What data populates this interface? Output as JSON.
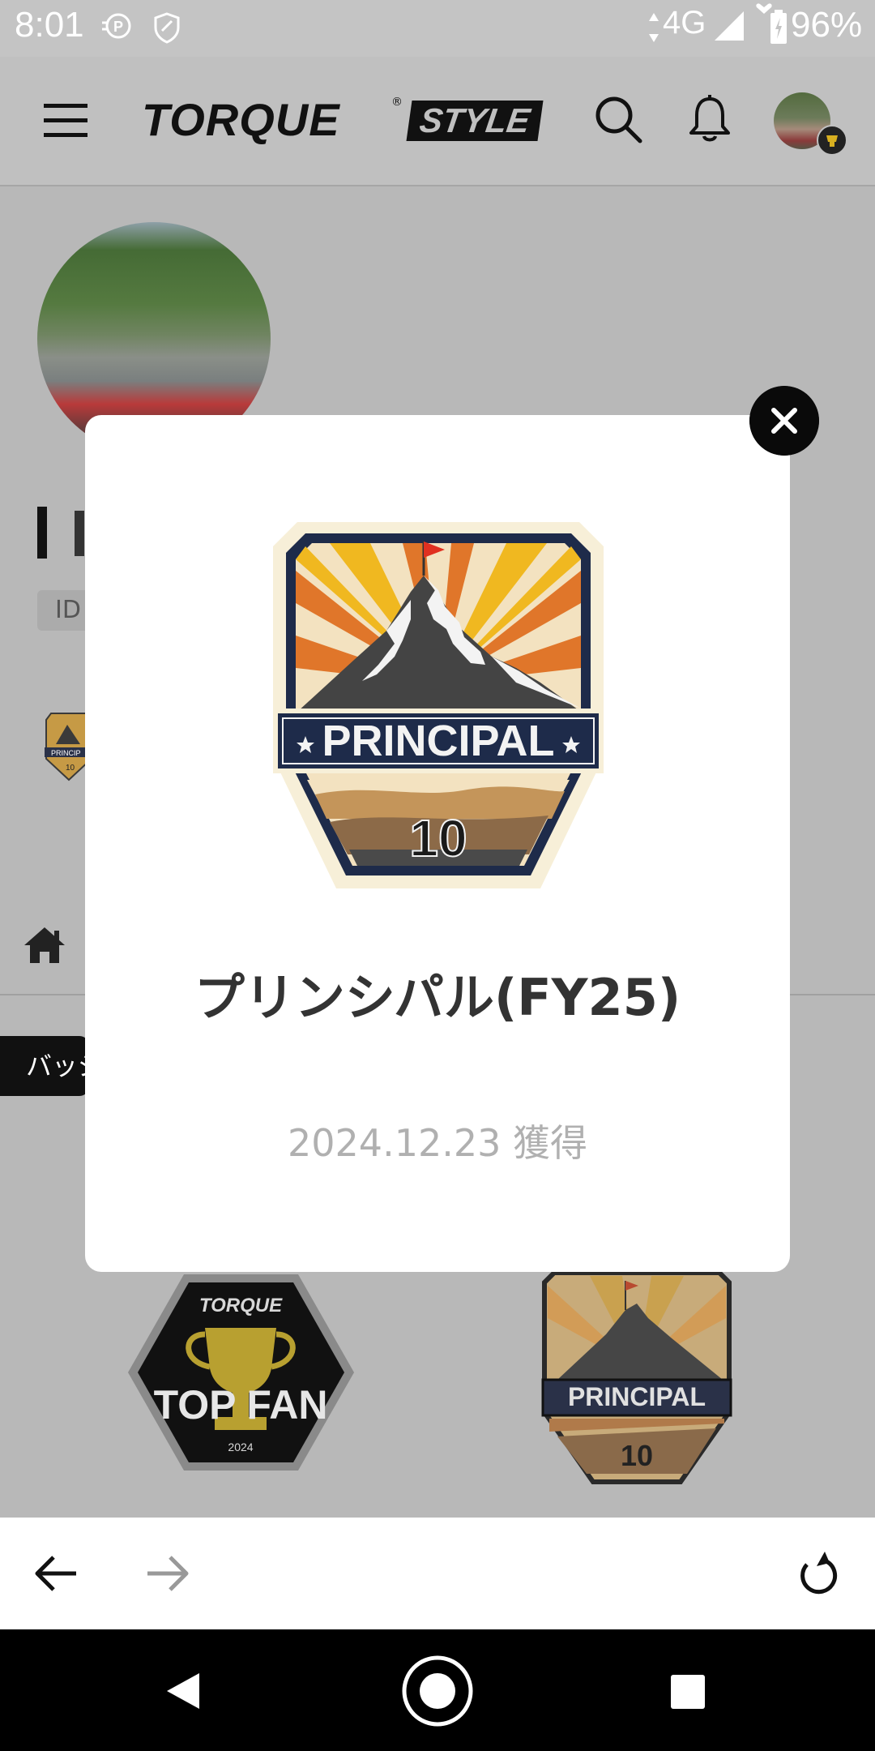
{
  "status_bar": {
    "time": "8:01",
    "network": "4G",
    "battery": "96%"
  },
  "header": {
    "logo_main": "TORQUE",
    "logo_reg": "®",
    "logo_tag": "STYLE"
  },
  "profile": {
    "id_chip": "ID",
    "badge_tab_label": "バッジ"
  },
  "badges_grid": [
    {
      "brand": "TORQUE",
      "title": "TOP FAN",
      "year": "2024"
    },
    {
      "title": "PRINCIPAL",
      "number": "10"
    }
  ],
  "modal": {
    "badge_title": "PRINCIPAL",
    "badge_number": "10",
    "title": "プリンシパル(FY25)",
    "acquired": "2024.12.23 獲得"
  },
  "colors": {
    "accent_black": "#0a0a0a",
    "overlay_gray": "#b8b8b8",
    "badge_navy": "#1e2b4a",
    "badge_orange": "#e0762a",
    "badge_yellow": "#f0b820",
    "flag_red": "#e03020"
  }
}
